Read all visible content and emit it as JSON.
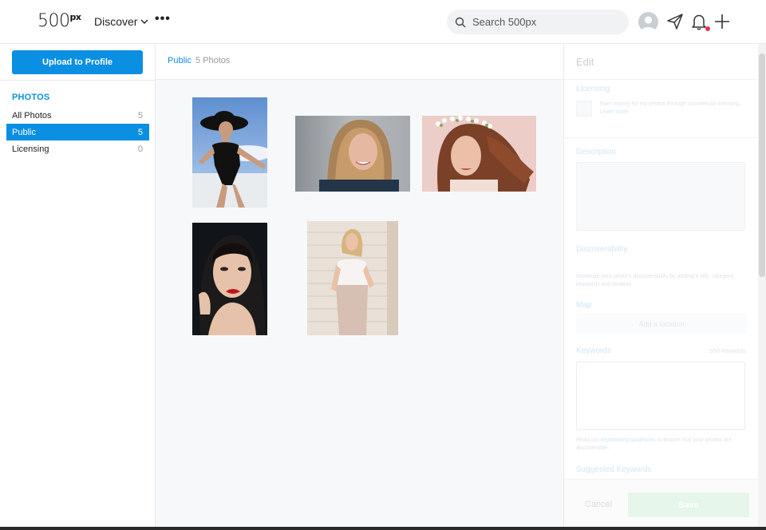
{
  "header": {
    "logo": "500",
    "logo_sup": "px",
    "discover_label": "Discover",
    "more_label": "•••",
    "search_placeholder": "Search 500px"
  },
  "sidebar": {
    "upload_label": "Upload to Profile",
    "section_title": "PHOTOS",
    "items": [
      {
        "label": "All Photos",
        "count": "5"
      },
      {
        "label": "Public",
        "count": "5"
      },
      {
        "label": "Licensing",
        "count": "0"
      }
    ]
  },
  "main": {
    "breadcrumb": "Public",
    "photo_count": "5 Photos"
  },
  "edit": {
    "title": "Edit",
    "licensing_label": "Licensing",
    "licensing_text": "Earn money for my photos through commercial licensing.",
    "licensing_link": "Learn more",
    "description_label": "Description",
    "discoverability_label": "Discoverability",
    "discoverability_text": "Maximize your photo's discoverability by adding a title, category, keywords and location.",
    "map_label": "Map",
    "add_location_label": "Add a location",
    "keywords_label": "Keywords",
    "keywords_counter": "0/50 Keywords",
    "keywords_note_prefix": "Read our",
    "keywords_note_link": "keywording guidelines",
    "keywords_note_suffix": "to ensure that your photos are discoverable.",
    "suggested_label": "Suggested Keywords",
    "cancel_label": "Cancel",
    "save_label": "Save"
  },
  "colors": {
    "accent": "#0b8fe3",
    "notification_dot": "#e8334a"
  }
}
